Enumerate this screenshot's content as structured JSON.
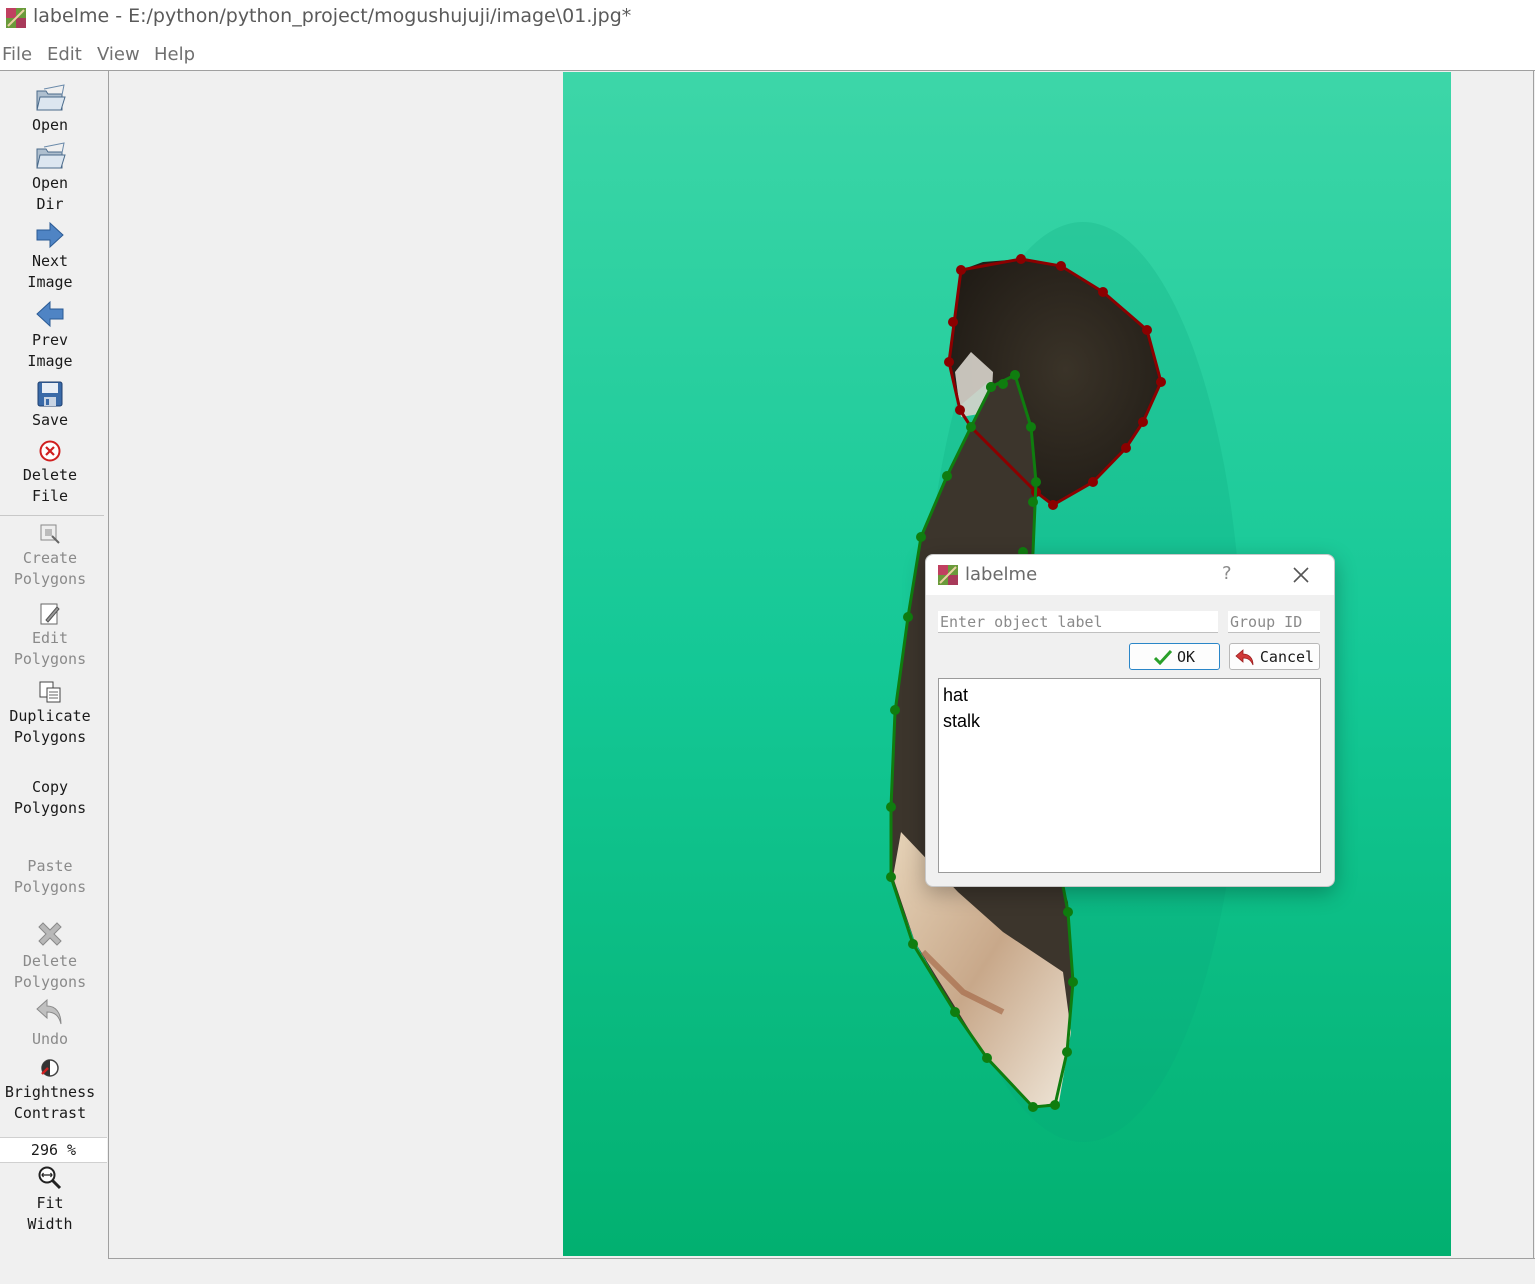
{
  "window": {
    "app_name": "labelme",
    "title": "labelme - E:/python/python_project/mogushujuji/image\\01.jpg*"
  },
  "menu": [
    "File",
    "Edit",
    "View",
    "Help"
  ],
  "toolbar": {
    "open": "Open",
    "open_dir": [
      "Open",
      "Dir"
    ],
    "next_image": [
      "Next",
      "Image"
    ],
    "prev_image": [
      "Prev",
      "Image"
    ],
    "save": "Save",
    "delete_file": [
      "Delete",
      "File"
    ],
    "create_polygons": [
      "Create",
      "Polygons"
    ],
    "edit_polygons": [
      "Edit",
      "Polygons"
    ],
    "duplicate_polygons": [
      "Duplicate",
      "Polygons"
    ],
    "copy_polygons": [
      "Copy",
      "Polygons"
    ],
    "paste_polygons": [
      "Paste",
      "Polygons"
    ],
    "delete_polygons": [
      "Delete",
      "Polygons"
    ],
    "undo": "Undo",
    "brightness_contrast": [
      "Brightness",
      "Contrast"
    ],
    "zoom": "296 %",
    "fit_width": [
      "Fit",
      "Width"
    ]
  },
  "canvas": {
    "polygon_colors": {
      "hat": "#8b0000",
      "stalk": "#0f7d0f"
    },
    "background_color": "#1ec996"
  },
  "dialog": {
    "title": "labelme",
    "help": "?",
    "label_placeholder": "Enter object label",
    "group_placeholder": "Group ID",
    "ok_label": "OK",
    "cancel_label": "Cancel",
    "labels": [
      "hat",
      "stalk"
    ]
  }
}
